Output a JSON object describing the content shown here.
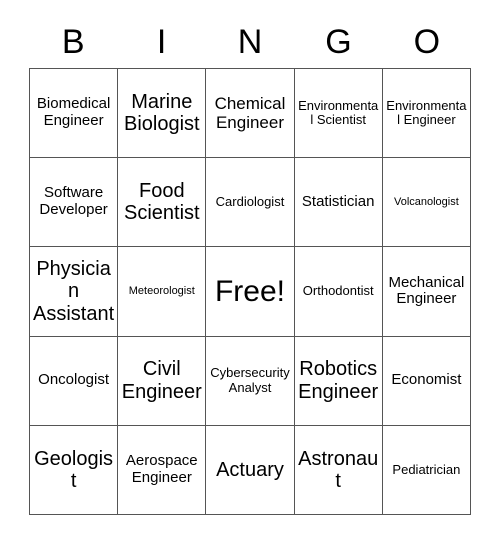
{
  "card": {
    "header_letters": [
      "B",
      "I",
      "N",
      "G",
      "O"
    ],
    "grid": {
      "rows": 5,
      "columns": 5,
      "border_color": "#555555",
      "background_color": "#ffffff",
      "text_color": "#000000"
    },
    "cells": [
      {
        "label": "Biomedical Engineer",
        "size": "fs-m",
        "free": false
      },
      {
        "label": "Marine Biologist",
        "size": "fs-xl",
        "free": false
      },
      {
        "label": "Chemical Engineer",
        "size": "fs-l",
        "free": false
      },
      {
        "label": "Environmental Scientist",
        "size": "fs-s",
        "free": false
      },
      {
        "label": "Environmental Engineer",
        "size": "fs-s",
        "free": false
      },
      {
        "label": "Software Developer",
        "size": "fs-m",
        "free": false
      },
      {
        "label": "Food Scientist",
        "size": "fs-xl",
        "free": false
      },
      {
        "label": "Cardiologist",
        "size": "fs-s",
        "free": false
      },
      {
        "label": "Statistician",
        "size": "fs-m",
        "free": false
      },
      {
        "label": "Volcanologist",
        "size": "fs-xs",
        "free": false
      },
      {
        "label": "Physician Assistant",
        "size": "fs-xl",
        "free": false
      },
      {
        "label": "Meteorologist",
        "size": "fs-xs",
        "free": false
      },
      {
        "label": "Free!",
        "size": "fs-xxl",
        "free": true
      },
      {
        "label": "Orthodontist",
        "size": "fs-s",
        "free": false
      },
      {
        "label": "Mechanical Engineer",
        "size": "fs-m",
        "free": false
      },
      {
        "label": "Oncologist",
        "size": "fs-m",
        "free": false
      },
      {
        "label": "Civil Engineer",
        "size": "fs-xl",
        "free": false
      },
      {
        "label": "Cybersecurity Analyst",
        "size": "fs-s",
        "free": false
      },
      {
        "label": "Robotics Engineer",
        "size": "fs-xl",
        "free": false
      },
      {
        "label": "Economist",
        "size": "fs-m",
        "free": false
      },
      {
        "label": "Geologist",
        "size": "fs-xl",
        "free": false
      },
      {
        "label": "Aerospace Engineer",
        "size": "fs-m",
        "free": false
      },
      {
        "label": "Actuary",
        "size": "fs-xl",
        "free": false
      },
      {
        "label": "Astronaut",
        "size": "fs-xl",
        "free": false
      },
      {
        "label": "Pediatrician",
        "size": "fs-s",
        "free": false
      }
    ]
  }
}
